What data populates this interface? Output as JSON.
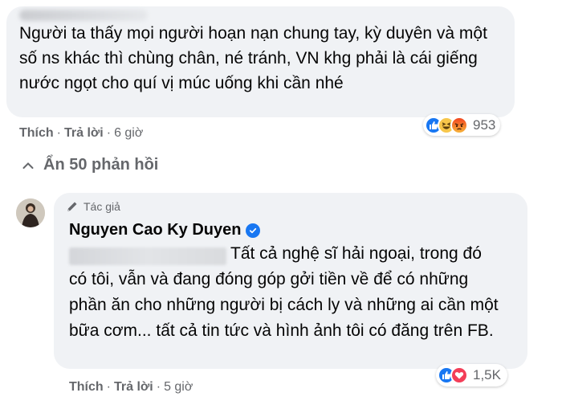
{
  "comment1": {
    "text": "Người ta thấy mọi người hoạn nạn chung tay, kỳ duyên và một số ns khác thì chùng chân, né tránh, VN khg phải là cái giếng nước ngọt cho quí vị múc uống khi cần nhé",
    "reaction_count": "953",
    "reactions": [
      "like-icon",
      "haha-icon",
      "angry-icon"
    ],
    "actions": {
      "like": "Thích",
      "reply": "Trả lời",
      "time": "6 giờ"
    }
  },
  "replies_toggle": {
    "label": "Ẩn 50 phản hồi"
  },
  "reply": {
    "badge": "Tác giả",
    "author": "Nguyen Cao Ky Duyen",
    "text": "Tất cả nghệ sĩ hải ngoại, trong đó có tôi, vẫn và đang đóng góp gởi tiền về để có những phần ăn cho những người bị cách ly và những ai cần một bữa cơm... tất cả tin tức và hình ảnh tôi có đăng trên FB.",
    "reaction_count": "1,5K",
    "reactions": [
      "like-icon",
      "love-icon"
    ],
    "actions": {
      "like": "Thích",
      "reply": "Trả lời",
      "time": "5 giờ"
    }
  },
  "colors": {
    "bubble": "#f0f2f5",
    "secondary_text": "#65676b",
    "like_blue": "#1877f2",
    "love_red": "#f33e58"
  }
}
